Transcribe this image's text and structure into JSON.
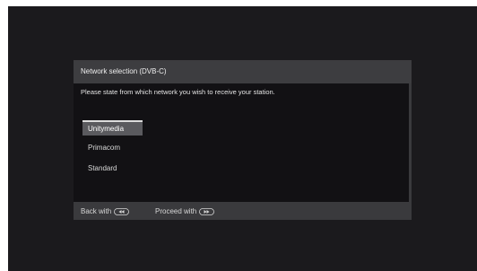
{
  "dialog": {
    "title": "Network selection (DVB-C)",
    "prompt": "Please state from which network you wish to receive your station."
  },
  "networks": [
    {
      "label": "Unitymedia",
      "selected": true
    },
    {
      "label": "Primacom",
      "selected": false
    },
    {
      "label": "Standard",
      "selected": false
    }
  ],
  "footer": {
    "back_label": "Back with",
    "back_icon": "rewind-button-icon",
    "proceed_label": "Proceed with",
    "proceed_icon": "fast-forward-button-icon"
  },
  "colors": {
    "screen_background": "#1b1a1d",
    "dialog_frame": "#3a3a3d",
    "dialog_body": "#121114",
    "selected_item": "#5a5a5e",
    "text": "#e4e4e4"
  }
}
